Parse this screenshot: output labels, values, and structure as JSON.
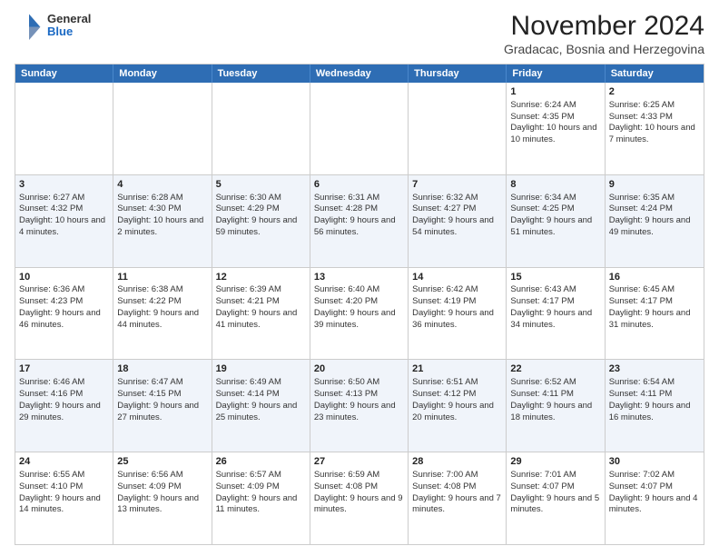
{
  "header": {
    "logo_general": "General",
    "logo_blue": "Blue",
    "month_title": "November 2024",
    "subtitle": "Gradacac, Bosnia and Herzegovina"
  },
  "days_of_week": [
    "Sunday",
    "Monday",
    "Tuesday",
    "Wednesday",
    "Thursday",
    "Friday",
    "Saturday"
  ],
  "weeks": [
    {
      "alt": false,
      "cells": [
        {
          "day": "",
          "sunrise": "",
          "sunset": "",
          "daylight": ""
        },
        {
          "day": "",
          "sunrise": "",
          "sunset": "",
          "daylight": ""
        },
        {
          "day": "",
          "sunrise": "",
          "sunset": "",
          "daylight": ""
        },
        {
          "day": "",
          "sunrise": "",
          "sunset": "",
          "daylight": ""
        },
        {
          "day": "",
          "sunrise": "",
          "sunset": "",
          "daylight": ""
        },
        {
          "day": "1",
          "sunrise": "Sunrise: 6:24 AM",
          "sunset": "Sunset: 4:35 PM",
          "daylight": "Daylight: 10 hours and 10 minutes."
        },
        {
          "day": "2",
          "sunrise": "Sunrise: 6:25 AM",
          "sunset": "Sunset: 4:33 PM",
          "daylight": "Daylight: 10 hours and 7 minutes."
        }
      ]
    },
    {
      "alt": true,
      "cells": [
        {
          "day": "3",
          "sunrise": "Sunrise: 6:27 AM",
          "sunset": "Sunset: 4:32 PM",
          "daylight": "Daylight: 10 hours and 4 minutes."
        },
        {
          "day": "4",
          "sunrise": "Sunrise: 6:28 AM",
          "sunset": "Sunset: 4:30 PM",
          "daylight": "Daylight: 10 hours and 2 minutes."
        },
        {
          "day": "5",
          "sunrise": "Sunrise: 6:30 AM",
          "sunset": "Sunset: 4:29 PM",
          "daylight": "Daylight: 9 hours and 59 minutes."
        },
        {
          "day": "6",
          "sunrise": "Sunrise: 6:31 AM",
          "sunset": "Sunset: 4:28 PM",
          "daylight": "Daylight: 9 hours and 56 minutes."
        },
        {
          "day": "7",
          "sunrise": "Sunrise: 6:32 AM",
          "sunset": "Sunset: 4:27 PM",
          "daylight": "Daylight: 9 hours and 54 minutes."
        },
        {
          "day": "8",
          "sunrise": "Sunrise: 6:34 AM",
          "sunset": "Sunset: 4:25 PM",
          "daylight": "Daylight: 9 hours and 51 minutes."
        },
        {
          "day": "9",
          "sunrise": "Sunrise: 6:35 AM",
          "sunset": "Sunset: 4:24 PM",
          "daylight": "Daylight: 9 hours and 49 minutes."
        }
      ]
    },
    {
      "alt": false,
      "cells": [
        {
          "day": "10",
          "sunrise": "Sunrise: 6:36 AM",
          "sunset": "Sunset: 4:23 PM",
          "daylight": "Daylight: 9 hours and 46 minutes."
        },
        {
          "day": "11",
          "sunrise": "Sunrise: 6:38 AM",
          "sunset": "Sunset: 4:22 PM",
          "daylight": "Daylight: 9 hours and 44 minutes."
        },
        {
          "day": "12",
          "sunrise": "Sunrise: 6:39 AM",
          "sunset": "Sunset: 4:21 PM",
          "daylight": "Daylight: 9 hours and 41 minutes."
        },
        {
          "day": "13",
          "sunrise": "Sunrise: 6:40 AM",
          "sunset": "Sunset: 4:20 PM",
          "daylight": "Daylight: 9 hours and 39 minutes."
        },
        {
          "day": "14",
          "sunrise": "Sunrise: 6:42 AM",
          "sunset": "Sunset: 4:19 PM",
          "daylight": "Daylight: 9 hours and 36 minutes."
        },
        {
          "day": "15",
          "sunrise": "Sunrise: 6:43 AM",
          "sunset": "Sunset: 4:17 PM",
          "daylight": "Daylight: 9 hours and 34 minutes."
        },
        {
          "day": "16",
          "sunrise": "Sunrise: 6:45 AM",
          "sunset": "Sunset: 4:17 PM",
          "daylight": "Daylight: 9 hours and 31 minutes."
        }
      ]
    },
    {
      "alt": true,
      "cells": [
        {
          "day": "17",
          "sunrise": "Sunrise: 6:46 AM",
          "sunset": "Sunset: 4:16 PM",
          "daylight": "Daylight: 9 hours and 29 minutes."
        },
        {
          "day": "18",
          "sunrise": "Sunrise: 6:47 AM",
          "sunset": "Sunset: 4:15 PM",
          "daylight": "Daylight: 9 hours and 27 minutes."
        },
        {
          "day": "19",
          "sunrise": "Sunrise: 6:49 AM",
          "sunset": "Sunset: 4:14 PM",
          "daylight": "Daylight: 9 hours and 25 minutes."
        },
        {
          "day": "20",
          "sunrise": "Sunrise: 6:50 AM",
          "sunset": "Sunset: 4:13 PM",
          "daylight": "Daylight: 9 hours and 23 minutes."
        },
        {
          "day": "21",
          "sunrise": "Sunrise: 6:51 AM",
          "sunset": "Sunset: 4:12 PM",
          "daylight": "Daylight: 9 hours and 20 minutes."
        },
        {
          "day": "22",
          "sunrise": "Sunrise: 6:52 AM",
          "sunset": "Sunset: 4:11 PM",
          "daylight": "Daylight: 9 hours and 18 minutes."
        },
        {
          "day": "23",
          "sunrise": "Sunrise: 6:54 AM",
          "sunset": "Sunset: 4:11 PM",
          "daylight": "Daylight: 9 hours and 16 minutes."
        }
      ]
    },
    {
      "alt": false,
      "cells": [
        {
          "day": "24",
          "sunrise": "Sunrise: 6:55 AM",
          "sunset": "Sunset: 4:10 PM",
          "daylight": "Daylight: 9 hours and 14 minutes."
        },
        {
          "day": "25",
          "sunrise": "Sunrise: 6:56 AM",
          "sunset": "Sunset: 4:09 PM",
          "daylight": "Daylight: 9 hours and 13 minutes."
        },
        {
          "day": "26",
          "sunrise": "Sunrise: 6:57 AM",
          "sunset": "Sunset: 4:09 PM",
          "daylight": "Daylight: 9 hours and 11 minutes."
        },
        {
          "day": "27",
          "sunrise": "Sunrise: 6:59 AM",
          "sunset": "Sunset: 4:08 PM",
          "daylight": "Daylight: 9 hours and 9 minutes."
        },
        {
          "day": "28",
          "sunrise": "Sunrise: 7:00 AM",
          "sunset": "Sunset: 4:08 PM",
          "daylight": "Daylight: 9 hours and 7 minutes."
        },
        {
          "day": "29",
          "sunrise": "Sunrise: 7:01 AM",
          "sunset": "Sunset: 4:07 PM",
          "daylight": "Daylight: 9 hours and 5 minutes."
        },
        {
          "day": "30",
          "sunrise": "Sunrise: 7:02 AM",
          "sunset": "Sunset: 4:07 PM",
          "daylight": "Daylight: 9 hours and 4 minutes."
        }
      ]
    }
  ]
}
